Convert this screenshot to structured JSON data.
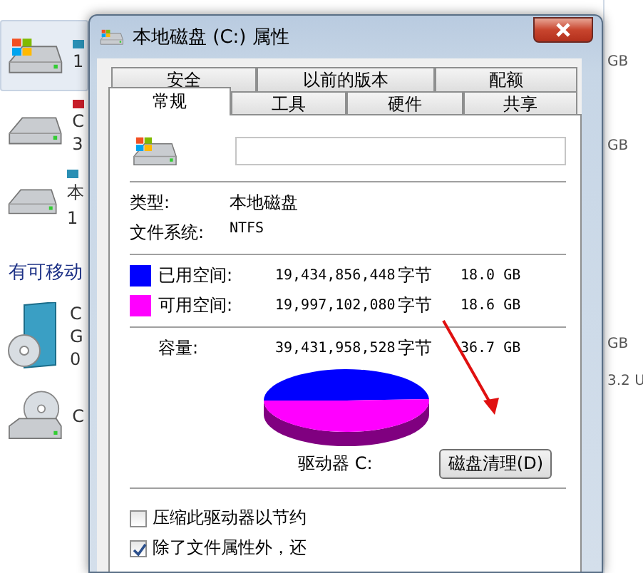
{
  "explorer": {
    "drives": [
      {
        "kind": "hdd-windows",
        "selected": true,
        "color": "#2a8fb4",
        "fragments": [
          "1"
        ]
      },
      {
        "kind": "hdd",
        "selected": false,
        "color": "#c81e2a",
        "fragments": [
          "C",
          "3"
        ]
      },
      {
        "kind": "hdd",
        "selected": false,
        "color": "#2a8fb4",
        "fragments": [
          "本",
          "1"
        ]
      }
    ],
    "section_header": "有可移动",
    "removable": [
      {
        "kind": "cd-box",
        "selected": false,
        "fragments": [
          "C",
          "G",
          "0"
        ]
      },
      {
        "kind": "dvd-drive",
        "selected": false,
        "fragments": [
          "C"
        ]
      }
    ],
    "right_texts": [
      "GB",
      "GB",
      "GB",
      "3.2 U"
    ]
  },
  "dialog": {
    "title": "本地磁盘 (C:) 属性",
    "tabs_back": [
      {
        "label": "安全",
        "selected": false
      },
      {
        "label": "以前的版本",
        "selected": false
      },
      {
        "label": "配额",
        "selected": false
      }
    ],
    "tabs_front": [
      {
        "label": "常规",
        "selected": true
      },
      {
        "label": "工具",
        "selected": false
      },
      {
        "label": "硬件",
        "selected": false
      },
      {
        "label": "共享",
        "selected": false
      }
    ],
    "info": [
      {
        "label": "类型:",
        "value": "本地磁盘"
      },
      {
        "label": "文件系统:",
        "value": "NTFS"
      }
    ],
    "space": [
      {
        "label": "已用空间:",
        "color": "#0000ff",
        "bytes": "19,434,856,448",
        "unit": "字节",
        "size": "18.0 GB"
      },
      {
        "label": "可用空间:",
        "color": "#ff00ff",
        "bytes": "19,997,102,080",
        "unit": "字节",
        "size": "18.6 GB"
      }
    ],
    "capacity": {
      "label": "容量:",
      "bytes": "39,431,958,528",
      "unit": "字节",
      "size": "36.7 GB"
    },
    "drive_label": "驱动器 C:",
    "cleanup_button": "磁盘清理(D)",
    "options": [
      {
        "label": "压缩此驱动器以节约",
        "checked": false
      },
      {
        "label": "除了文件属性外，还",
        "checked": true
      }
    ]
  }
}
